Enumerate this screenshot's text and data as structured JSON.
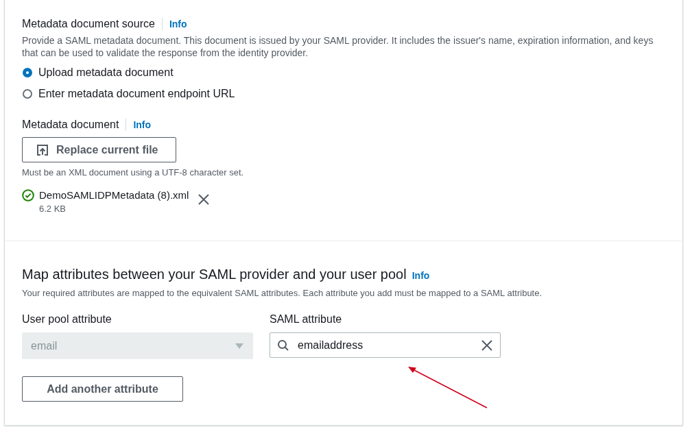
{
  "source": {
    "label": "Metadata document source",
    "info": "Info",
    "description": "Provide a SAML metadata document. This document is issued by your SAML provider. It includes the issuer's name, expiration information, and keys that can be used to validate the response from the identity provider.",
    "options": [
      {
        "label": "Upload metadata document",
        "selected": true
      },
      {
        "label": "Enter metadata document endpoint URL",
        "selected": false
      }
    ]
  },
  "document": {
    "label": "Metadata document",
    "info": "Info",
    "button": "Replace current file",
    "constraint": "Must be an XML document using a UTF-8 character set.",
    "file": {
      "name": "DemoSAMLIDPMetadata (8).xml",
      "size": "6.2 KB"
    }
  },
  "mapping": {
    "title": "Map attributes between your SAML provider and your user pool",
    "info": "Info",
    "description": "Your required attributes are mapped to the equivalent SAML attributes. Each attribute you add must be mapped to a SAML attribute.",
    "user_pool_label": "User pool attribute",
    "user_pool_value": "email",
    "user_pool_disabled": true,
    "saml_label": "SAML attribute",
    "saml_value": "emailaddress",
    "add_button": "Add another attribute"
  }
}
